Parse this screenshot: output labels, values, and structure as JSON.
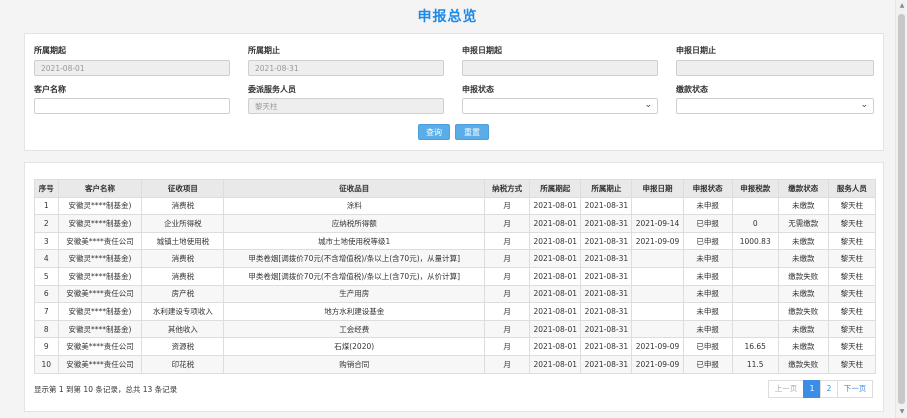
{
  "page": {
    "title": "申报总览"
  },
  "filters": {
    "period_start": {
      "label": "所属期起",
      "value": "2021-08-01"
    },
    "period_end": {
      "label": "所属期止",
      "value": "2021-08-31"
    },
    "declare_start": {
      "label": "申报日期起",
      "value": ""
    },
    "declare_end": {
      "label": "申报日期止",
      "value": ""
    },
    "customer": {
      "label": "客户名称",
      "value": ""
    },
    "agent": {
      "label": "委派服务人员",
      "value": "黎天柱"
    },
    "declare_status": {
      "label": "申报状态",
      "value": ""
    },
    "pay_status": {
      "label": "缴款状态",
      "value": ""
    },
    "query_label": "查询",
    "reset_label": "重置"
  },
  "table": {
    "columns": [
      "序号",
      "客户名称",
      "征收项目",
      "征收品目",
      "纳税方式",
      "所属期起",
      "所属期止",
      "申报日期",
      "申报状态",
      "申报税款",
      "缴款状态",
      "服务人员"
    ],
    "rows": [
      [
        "1",
        "安徽灵****制基金)",
        "消费税",
        "涂料",
        "月",
        "2021-08-01",
        "2021-08-31",
        "",
        "未申报",
        "",
        "未缴款",
        "黎天柱"
      ],
      [
        "2",
        "安徽灵****制基金)",
        "企业所得税",
        "应纳税所得额",
        "月",
        "2021-08-01",
        "2021-08-31",
        "2021-09-14",
        "已申报",
        "0",
        "无需缴款",
        "黎天柱"
      ],
      [
        "3",
        "安徽美****责任公司",
        "城镇土地使用税",
        "城市土地使用税等级1",
        "月",
        "2021-08-01",
        "2021-08-31",
        "2021-09-09",
        "已申报",
        "1000.83",
        "未缴款",
        "黎天柱"
      ],
      [
        "4",
        "安徽灵****制基金)",
        "消费税",
        "甲类卷烟[调拨价70元(不含增值税)/条以上(含70元)，从量计算]",
        "月",
        "2021-08-01",
        "2021-08-31",
        "",
        "未申报",
        "",
        "未缴款",
        "黎天柱"
      ],
      [
        "5",
        "安徽灵****制基金)",
        "消费税",
        "甲类卷烟[调拨价70元(不含增值税)/条以上(含70元)，从价计算]",
        "月",
        "2021-08-01",
        "2021-08-31",
        "",
        "未申报",
        "",
        "缴款失败",
        "黎天柱"
      ],
      [
        "6",
        "安徽美****责任公司",
        "房产税",
        "生产用房",
        "月",
        "2021-08-01",
        "2021-08-31",
        "",
        "未申报",
        "",
        "未缴款",
        "黎天柱"
      ],
      [
        "7",
        "安徽灵****制基金)",
        "水利建设专项收入",
        "地方水利建设基金",
        "月",
        "2021-08-01",
        "2021-08-31",
        "",
        "未申报",
        "",
        "缴款失败",
        "黎天柱"
      ],
      [
        "8",
        "安徽灵****制基金)",
        "其他收入",
        "工会经费",
        "月",
        "2021-08-01",
        "2021-08-31",
        "",
        "未申报",
        "",
        "未缴款",
        "黎天柱"
      ],
      [
        "9",
        "安徽美****责任公司",
        "资源税",
        "石煤(2020)",
        "月",
        "2021-08-01",
        "2021-08-31",
        "2021-09-09",
        "已申报",
        "16.65",
        "未缴款",
        "黎天柱"
      ],
      [
        "10",
        "安徽美****责任公司",
        "印花税",
        "购销合同",
        "月",
        "2021-08-01",
        "2021-08-31",
        "2021-09-09",
        "已申报",
        "11.5",
        "缴款失败",
        "黎天柱"
      ]
    ]
  },
  "summary": "显示第 1 到第 10 条记录，总共 13 条记录",
  "pagination": {
    "prev": "上一页",
    "pages": [
      "1",
      "2"
    ],
    "active": "1",
    "next": "下一页"
  }
}
